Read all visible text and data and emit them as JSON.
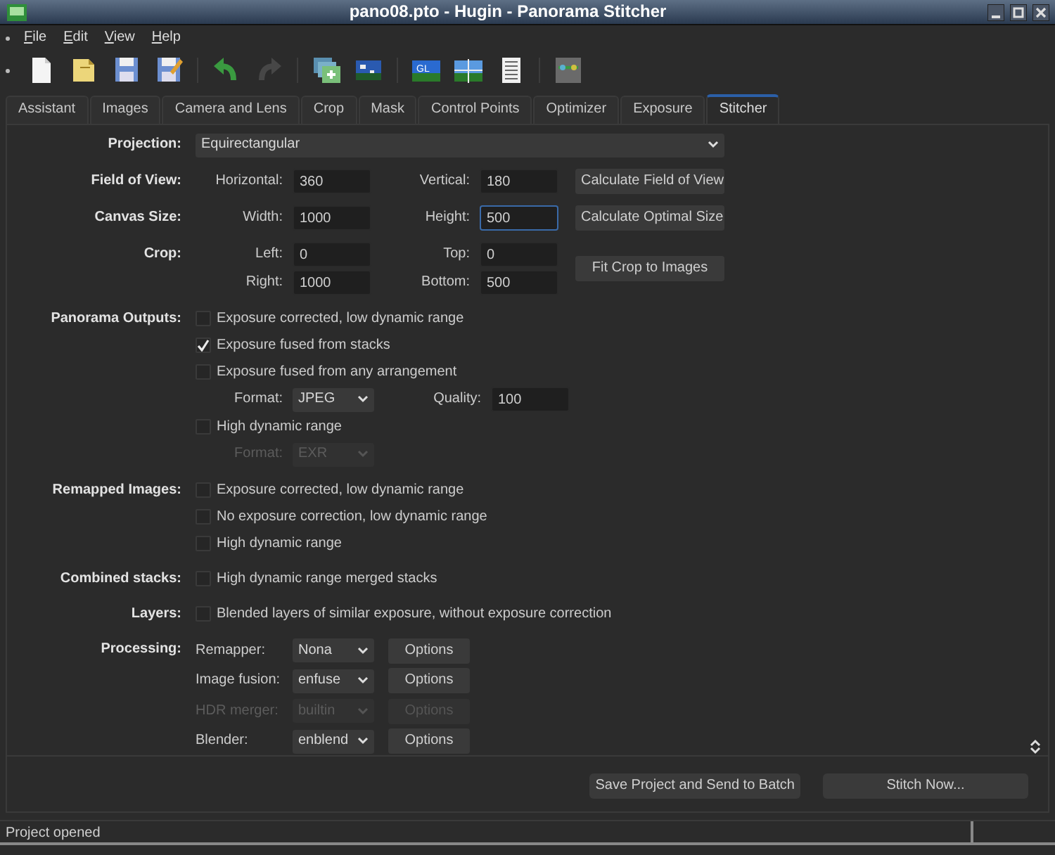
{
  "window": {
    "title": "pano08.pto - Hugin - Panorama Stitcher"
  },
  "menu": [
    "File",
    "Edit",
    "View",
    "Help"
  ],
  "toolbar": [
    [
      {
        "kind": "new",
        "disabled": false
      },
      {
        "kind": "open",
        "disabled": false
      },
      {
        "kind": "save",
        "disabled": false
      },
      {
        "kind": "save_as",
        "disabled": false
      }
    ],
    [
      {
        "kind": "undo",
        "disabled": false
      },
      {
        "kind": "redo",
        "disabled": true
      }
    ],
    [
      {
        "kind": "add_images",
        "disabled": false
      },
      {
        "kind": "preview",
        "disabled": false
      }
    ],
    [
      {
        "kind": "gl_preview",
        "text": "GL",
        "disabled": false
      },
      {
        "kind": "layout",
        "disabled": false
      },
      {
        "kind": "list",
        "disabled": false
      }
    ],
    [
      {
        "kind": "editor",
        "disabled": false
      }
    ]
  ],
  "tabs": [
    {
      "label": "Assistant",
      "selected": false
    },
    {
      "label": "Images",
      "selected": false
    },
    {
      "label": "Camera and Lens",
      "selected": false
    },
    {
      "label": "Crop",
      "selected": false
    },
    {
      "label": "Mask",
      "selected": false
    },
    {
      "label": "Control Points",
      "selected": false
    },
    {
      "label": "Optimizer",
      "selected": false
    },
    {
      "label": "Exposure",
      "selected": false
    },
    {
      "label": "Stitcher",
      "selected": true
    }
  ],
  "sections": [
    {
      "label": "Projection:",
      "rows": [
        {
          "kind": "select",
          "value": "Equirectangular"
        }
      ]
    },
    {
      "label": "Field of View:",
      "rows": [
        {
          "kind": "fields",
          "fields": [
            {
              "label": "Horizontal:",
              "value": "360",
              "focused": false
            },
            {
              "label": "Vertical:",
              "value": "180",
              "focused": false
            }
          ]
        }
      ],
      "button": "Calculate Field of View"
    },
    {
      "label": "Canvas Size:",
      "rows": [
        {
          "kind": "fields",
          "fields": [
            {
              "label": "Width:",
              "value": "1000",
              "focused": false
            },
            {
              "label": "Height:",
              "value": "500",
              "focused": true
            }
          ]
        }
      ],
      "button": "Calculate Optimal Size"
    },
    {
      "label": "Crop:",
      "rows": [
        {
          "kind": "fields",
          "fields": [
            {
              "label": "Left:",
              "value": "0",
              "focused": false
            },
            {
              "label": "Top:",
              "value": "0",
              "focused": false
            }
          ]
        },
        {
          "kind": "fields",
          "fields": [
            {
              "label": "Right:",
              "value": "1000",
              "focused": false
            },
            {
              "label": "Bottom:",
              "value": "500",
              "focused": false
            }
          ]
        }
      ],
      "button": "Fit Crop to Images"
    },
    {
      "label": "Panorama Outputs:",
      "rows": [
        {
          "kind": "checkbox",
          "label": "Exposure corrected, low dynamic range",
          "checked": false
        },
        {
          "kind": "checkbox",
          "label": "Exposure fused from stacks",
          "checked": true
        },
        {
          "kind": "checkbox",
          "label": "Exposure fused from any arrangement",
          "checked": false
        },
        {
          "kind": "format",
          "label": "Format:",
          "value": "JPEG",
          "disabled": false,
          "fields": [
            {
              "label": "Quality:",
              "value": "100",
              "focused": false
            }
          ]
        },
        {
          "kind": "checkbox",
          "label": "High dynamic range",
          "checked": false
        },
        {
          "kind": "format",
          "label": "Format:",
          "value": "EXR",
          "disabled": true
        }
      ]
    },
    {
      "label": "Remapped Images:",
      "rows": [
        {
          "kind": "checkbox",
          "label": "Exposure corrected, low dynamic range",
          "checked": false
        },
        {
          "kind": "checkbox",
          "label": "No exposure correction, low dynamic range",
          "checked": false
        },
        {
          "kind": "checkbox",
          "label": "High dynamic range",
          "checked": false
        }
      ]
    },
    {
      "label": "Combined stacks:",
      "rows": [
        {
          "kind": "checkbox",
          "label": "High dynamic range merged stacks",
          "checked": false
        }
      ]
    },
    {
      "label": "Layers:",
      "rows": [
        {
          "kind": "checkbox",
          "label": "Blended layers of similar exposure, without exposure correction",
          "checked": false
        }
      ]
    },
    {
      "label": "Processing:",
      "rows": [
        {
          "kind": "processor",
          "label": "Remapper:",
          "value": "Nona",
          "button": "Options",
          "disabled": false
        },
        {
          "kind": "processor",
          "label": "Image fusion:",
          "value": "enfuse",
          "button": "Options",
          "disabled": false
        },
        {
          "kind": "processor",
          "label": "HDR merger:",
          "value": "builtin",
          "button": "Options",
          "disabled": true
        },
        {
          "kind": "processor",
          "label": "Blender:",
          "value": "enblend",
          "button": "Options",
          "disabled": false
        }
      ]
    }
  ],
  "footer_buttons": [
    "Save Project and Send to Batch",
    "Stitch Now..."
  ],
  "status_bar": "Project opened"
}
